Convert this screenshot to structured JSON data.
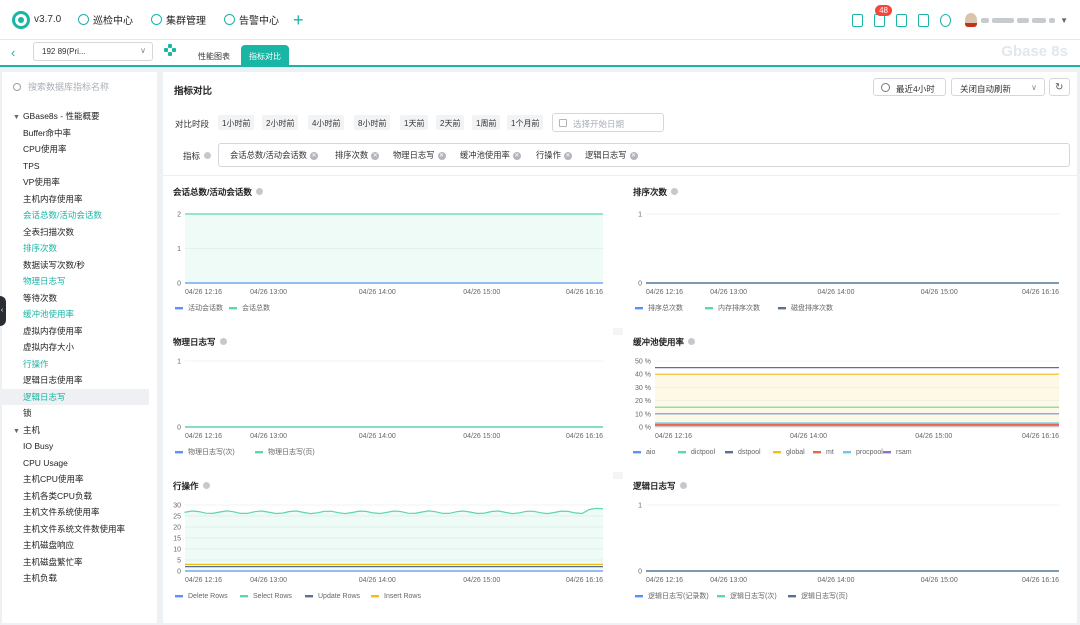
{
  "header": {
    "version": "v3.7.0",
    "nav": [
      {
        "label": "巡检中心",
        "icon": "inspect-icon"
      },
      {
        "label": "集群管理",
        "icon": "cluster-icon"
      },
      {
        "label": "告警中心",
        "icon": "alarm-icon"
      }
    ],
    "badge_count": "48",
    "right_icons": [
      "document-icon",
      "notification-icon",
      "clipboard-icon",
      "chat-icon",
      "settings-icon"
    ]
  },
  "tabbar": {
    "host": "192      89(Pri...",
    "tabs": [
      {
        "label": "性能图表",
        "active": false
      },
      {
        "label": "指标对比",
        "active": true
      }
    ],
    "watermark": "Gbase 8s"
  },
  "sidebar": {
    "search_placeholder": "搜索数据库指标名称",
    "items": [
      {
        "label": "GBase8s - 性能概要",
        "group": true
      },
      {
        "label": "Buffer命中率"
      },
      {
        "label": "CPU使用率"
      },
      {
        "label": "TPS"
      },
      {
        "label": "VP使用率"
      },
      {
        "label": "主机内存使用率"
      },
      {
        "label": "会话总数/活动会话数",
        "hl": true
      },
      {
        "label": "全表扫描次数"
      },
      {
        "label": "排序次数",
        "hl": true
      },
      {
        "label": "数据读写次数/秒"
      },
      {
        "label": "物理日志写",
        "hl": true
      },
      {
        "label": "等待次数"
      },
      {
        "label": "缓冲池使用率",
        "hl": true
      },
      {
        "label": "虚拟内存使用率"
      },
      {
        "label": "虚拟内存大小"
      },
      {
        "label": "行操作",
        "hl": true
      },
      {
        "label": "逻辑日志使用率"
      },
      {
        "label": "逻辑日志写",
        "hl": true,
        "sel": true
      },
      {
        "label": "锁"
      },
      {
        "label": "主机",
        "group": true
      },
      {
        "label": "IO Busy"
      },
      {
        "label": "CPU Usage"
      },
      {
        "label": "主机CPU使用率"
      },
      {
        "label": "主机各类CPU负载"
      },
      {
        "label": "主机文件系统使用率"
      },
      {
        "label": "主机文件系统文件数使用率"
      },
      {
        "label": "主机磁盘响应"
      },
      {
        "label": "主机磁盘繁忙率"
      },
      {
        "label": "主机负载"
      }
    ]
  },
  "main": {
    "title": "指标对比",
    "time_range": "最近4小时",
    "refresh": "关闭自动刷新",
    "compare_label": "对比时段",
    "periods": [
      "1小时前",
      "2小时前",
      "4小时前",
      "8小时前",
      "1天前",
      "2天前",
      "1周前",
      "1个月前"
    ],
    "date_placeholder": "选择开始日期",
    "metric_label": "指标",
    "metrics": [
      "会话总数/活动会话数",
      "排序次数",
      "物理日志写",
      "缓冲池使用率",
      "行操作",
      "逻辑日志写"
    ]
  },
  "colors": {
    "accent": "#19b5a5",
    "blue": "#5b8ff9",
    "green": "#5ad8a6",
    "slate": "#5d7092",
    "yellow": "#f6bd16",
    "red": "#e8684a",
    "cyan": "#6dc8ec",
    "purple": "#9270ca"
  },
  "chart_data": [
    {
      "type": "line",
      "title": "会话总数/活动会话数",
      "ylim": [
        0,
        2
      ],
      "yticks": [
        "0",
        "1",
        "2"
      ],
      "xticks": [
        "04/26 12:16",
        "04/26 13:00",
        "04/26 14:00",
        "04/26 15:00",
        "04/26 16:16"
      ],
      "series": [
        {
          "name": "活动会话数",
          "color": "#5b8ff9",
          "values": [
            0,
            0,
            0,
            0,
            0
          ]
        },
        {
          "name": "会话总数",
          "color": "#5ad8a6",
          "values": [
            2,
            2,
            2,
            2,
            2
          ]
        }
      ]
    },
    {
      "type": "line",
      "title": "排序次数",
      "ylim": [
        0,
        1
      ],
      "yticks": [
        "0",
        "1"
      ],
      "xticks": [
        "04/26 12:16",
        "04/26 13:00",
        "04/26 14:00",
        "04/26 15:00",
        "04/26 16:16"
      ],
      "series": [
        {
          "name": "排序总次数",
          "color": "#5b8ff9",
          "values": [
            0,
            0,
            0,
            0,
            0
          ]
        },
        {
          "name": "内存排序次数",
          "color": "#5ad8a6",
          "values": [
            0,
            0,
            0,
            0,
            0
          ]
        },
        {
          "name": "磁盘排序次数",
          "color": "#5d7092",
          "values": [
            0,
            0,
            0,
            0,
            0
          ]
        }
      ]
    },
    {
      "type": "line",
      "title": "物理日志写",
      "ylim": [
        0,
        1
      ],
      "yticks": [
        "0",
        "1"
      ],
      "xticks": [
        "04/26 12:16",
        "04/26 13:00",
        "04/26 14:00",
        "04/26 15:00",
        "04/26 16:16"
      ],
      "series": [
        {
          "name": "物理日志写(次)",
          "color": "#5b8ff9",
          "values": [
            0,
            0,
            0,
            0,
            0
          ]
        },
        {
          "name": "物理日志写(页)",
          "color": "#5ad8a6",
          "values": [
            0,
            0,
            0,
            0,
            0
          ]
        }
      ]
    },
    {
      "type": "line",
      "title": "缓冲池使用率",
      "ylim": [
        0,
        50
      ],
      "yticks": [
        "0 %",
        "10 %",
        "20 %",
        "30 %",
        "40 %",
        "50 %"
      ],
      "xticks": [
        "04/26 12:16",
        "04/26 14:00",
        "04/26 15:00",
        "04/26 16:16"
      ],
      "series": [
        {
          "name": "aio",
          "color": "#5b8ff9",
          "values": [
            10,
            10,
            10,
            10
          ]
        },
        {
          "name": "dictpool",
          "color": "#5ad8a6",
          "values": [
            15,
            15,
            15,
            15
          ]
        },
        {
          "name": "dstpool",
          "color": "#5d7092",
          "values": [
            45,
            45,
            45,
            45
          ]
        },
        {
          "name": "global",
          "color": "#f6bd16",
          "values": [
            40,
            40,
            40,
            40
          ]
        },
        {
          "name": "mt",
          "color": "#e8684a",
          "values": [
            2,
            2,
            2,
            2
          ]
        },
        {
          "name": "procpool",
          "color": "#6dc8ec",
          "values": [
            3,
            3,
            3,
            3
          ]
        },
        {
          "name": "rsam",
          "color": "#9270ca",
          "values": [
            1,
            1,
            1,
            1
          ]
        }
      ]
    },
    {
      "type": "line",
      "title": "行操作",
      "ylim": [
        0,
        30
      ],
      "yticks": [
        "0",
        "5",
        "10",
        "15",
        "20",
        "25",
        "30"
      ],
      "xticks": [
        "04/26 12:16",
        "04/26 13:00",
        "04/26 14:00",
        "04/26 15:00",
        "04/26 16:16"
      ],
      "series": [
        {
          "name": "Delete Rows",
          "color": "#5b8ff9",
          "values": [
            0,
            0,
            0,
            0,
            0
          ]
        },
        {
          "name": "Select Rows",
          "color": "#5ad8a6",
          "values": [
            26.5,
            27,
            26.8,
            27,
            28
          ]
        },
        {
          "name": "Update Rows",
          "color": "#5d7092",
          "values": [
            2,
            2,
            2,
            2,
            2
          ]
        },
        {
          "name": "Insert Rows",
          "color": "#f6bd16",
          "values": [
            3,
            3,
            3,
            3,
            3
          ]
        }
      ]
    },
    {
      "type": "line",
      "title": "逻辑日志写",
      "ylim": [
        0,
        1
      ],
      "yticks": [
        "0",
        "1"
      ],
      "xticks": [
        "04/26 12:16",
        "04/26 13:00",
        "04/26 14:00",
        "04/26 15:00",
        "04/26 16:16"
      ],
      "series": [
        {
          "name": "逻辑日志写(记录数)",
          "color": "#5b8ff9",
          "values": [
            0,
            0,
            0,
            0,
            0
          ]
        },
        {
          "name": "逻辑日志写(次)",
          "color": "#5ad8a6",
          "values": [
            0,
            0,
            0,
            0,
            0
          ]
        },
        {
          "name": "逻辑日志写(页)",
          "color": "#5d7092",
          "values": [
            0,
            0,
            0,
            0,
            0
          ]
        }
      ]
    }
  ]
}
